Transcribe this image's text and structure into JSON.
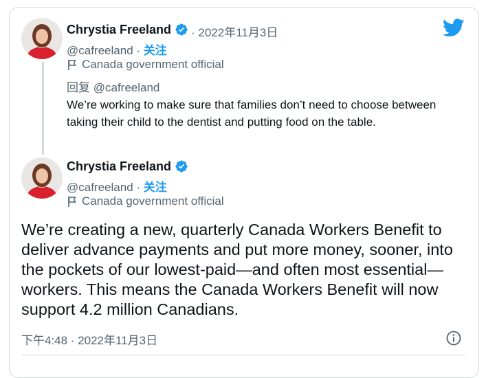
{
  "tweet_parent": {
    "author_name": "Chrystia Freeland",
    "date": "· 2022年11月3日",
    "handle": "@cafreeland",
    "separator": " · ",
    "follow_label": "关注",
    "account_label": "Canada government official",
    "reply_prefix": "回复",
    "reply_handle": "@cafreeland",
    "text": "We’re working to make sure that families don’t need to choose between taking their child to the dentist and putting food on the table."
  },
  "tweet_main": {
    "author_name": "Chrystia Freeland",
    "handle": "@cafreeland",
    "separator": " · ",
    "follow_label": "关注",
    "account_label": "Canada government official",
    "text": "We’re creating a new, quarterly Canada Workers Benefit to deliver advance payments and put more money, sooner, into the pockets of our lowest-paid—and often most essential—workers. This means the Canada Workers Benefit will now support 4.2 million Canadians.",
    "timestamp": "下午4:48 · 2022年11月3日"
  },
  "icons": {
    "logo": "twitter-bird-icon",
    "verified": "verified-badge-icon",
    "label": "government-flag-icon",
    "info": "info-icon"
  },
  "colors": {
    "accent": "#1d9bf0",
    "secondary_text": "#536471",
    "border": "#cfd9de"
  }
}
